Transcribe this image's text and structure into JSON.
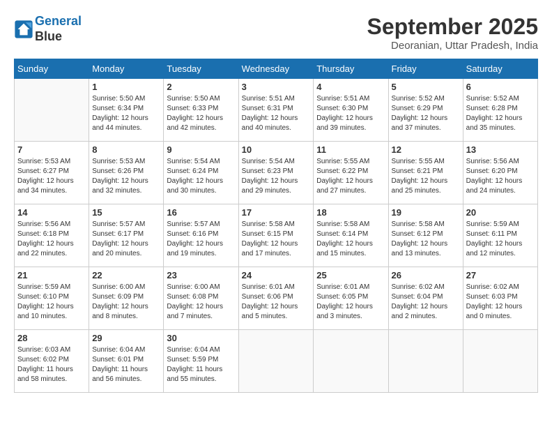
{
  "header": {
    "logo_line1": "General",
    "logo_line2": "Blue",
    "month": "September 2025",
    "location": "Deoranian, Uttar Pradesh, India"
  },
  "weekdays": [
    "Sunday",
    "Monday",
    "Tuesday",
    "Wednesday",
    "Thursday",
    "Friday",
    "Saturday"
  ],
  "weeks": [
    [
      {
        "day": "",
        "info": ""
      },
      {
        "day": "1",
        "info": "Sunrise: 5:50 AM\nSunset: 6:34 PM\nDaylight: 12 hours\nand 44 minutes."
      },
      {
        "day": "2",
        "info": "Sunrise: 5:50 AM\nSunset: 6:33 PM\nDaylight: 12 hours\nand 42 minutes."
      },
      {
        "day": "3",
        "info": "Sunrise: 5:51 AM\nSunset: 6:31 PM\nDaylight: 12 hours\nand 40 minutes."
      },
      {
        "day": "4",
        "info": "Sunrise: 5:51 AM\nSunset: 6:30 PM\nDaylight: 12 hours\nand 39 minutes."
      },
      {
        "day": "5",
        "info": "Sunrise: 5:52 AM\nSunset: 6:29 PM\nDaylight: 12 hours\nand 37 minutes."
      },
      {
        "day": "6",
        "info": "Sunrise: 5:52 AM\nSunset: 6:28 PM\nDaylight: 12 hours\nand 35 minutes."
      }
    ],
    [
      {
        "day": "7",
        "info": "Sunrise: 5:53 AM\nSunset: 6:27 PM\nDaylight: 12 hours\nand 34 minutes."
      },
      {
        "day": "8",
        "info": "Sunrise: 5:53 AM\nSunset: 6:26 PM\nDaylight: 12 hours\nand 32 minutes."
      },
      {
        "day": "9",
        "info": "Sunrise: 5:54 AM\nSunset: 6:24 PM\nDaylight: 12 hours\nand 30 minutes."
      },
      {
        "day": "10",
        "info": "Sunrise: 5:54 AM\nSunset: 6:23 PM\nDaylight: 12 hours\nand 29 minutes."
      },
      {
        "day": "11",
        "info": "Sunrise: 5:55 AM\nSunset: 6:22 PM\nDaylight: 12 hours\nand 27 minutes."
      },
      {
        "day": "12",
        "info": "Sunrise: 5:55 AM\nSunset: 6:21 PM\nDaylight: 12 hours\nand 25 minutes."
      },
      {
        "day": "13",
        "info": "Sunrise: 5:56 AM\nSunset: 6:20 PM\nDaylight: 12 hours\nand 24 minutes."
      }
    ],
    [
      {
        "day": "14",
        "info": "Sunrise: 5:56 AM\nSunset: 6:18 PM\nDaylight: 12 hours\nand 22 minutes."
      },
      {
        "day": "15",
        "info": "Sunrise: 5:57 AM\nSunset: 6:17 PM\nDaylight: 12 hours\nand 20 minutes."
      },
      {
        "day": "16",
        "info": "Sunrise: 5:57 AM\nSunset: 6:16 PM\nDaylight: 12 hours\nand 19 minutes."
      },
      {
        "day": "17",
        "info": "Sunrise: 5:58 AM\nSunset: 6:15 PM\nDaylight: 12 hours\nand 17 minutes."
      },
      {
        "day": "18",
        "info": "Sunrise: 5:58 AM\nSunset: 6:14 PM\nDaylight: 12 hours\nand 15 minutes."
      },
      {
        "day": "19",
        "info": "Sunrise: 5:58 AM\nSunset: 6:12 PM\nDaylight: 12 hours\nand 13 minutes."
      },
      {
        "day": "20",
        "info": "Sunrise: 5:59 AM\nSunset: 6:11 PM\nDaylight: 12 hours\nand 12 minutes."
      }
    ],
    [
      {
        "day": "21",
        "info": "Sunrise: 5:59 AM\nSunset: 6:10 PM\nDaylight: 12 hours\nand 10 minutes."
      },
      {
        "day": "22",
        "info": "Sunrise: 6:00 AM\nSunset: 6:09 PM\nDaylight: 12 hours\nand 8 minutes."
      },
      {
        "day": "23",
        "info": "Sunrise: 6:00 AM\nSunset: 6:08 PM\nDaylight: 12 hours\nand 7 minutes."
      },
      {
        "day": "24",
        "info": "Sunrise: 6:01 AM\nSunset: 6:06 PM\nDaylight: 12 hours\nand 5 minutes."
      },
      {
        "day": "25",
        "info": "Sunrise: 6:01 AM\nSunset: 6:05 PM\nDaylight: 12 hours\nand 3 minutes."
      },
      {
        "day": "26",
        "info": "Sunrise: 6:02 AM\nSunset: 6:04 PM\nDaylight: 12 hours\nand 2 minutes."
      },
      {
        "day": "27",
        "info": "Sunrise: 6:02 AM\nSunset: 6:03 PM\nDaylight: 12 hours\nand 0 minutes."
      }
    ],
    [
      {
        "day": "28",
        "info": "Sunrise: 6:03 AM\nSunset: 6:02 PM\nDaylight: 11 hours\nand 58 minutes."
      },
      {
        "day": "29",
        "info": "Sunrise: 6:04 AM\nSunset: 6:01 PM\nDaylight: 11 hours\nand 56 minutes."
      },
      {
        "day": "30",
        "info": "Sunrise: 6:04 AM\nSunset: 5:59 PM\nDaylight: 11 hours\nand 55 minutes."
      },
      {
        "day": "",
        "info": ""
      },
      {
        "day": "",
        "info": ""
      },
      {
        "day": "",
        "info": ""
      },
      {
        "day": "",
        "info": ""
      }
    ]
  ]
}
